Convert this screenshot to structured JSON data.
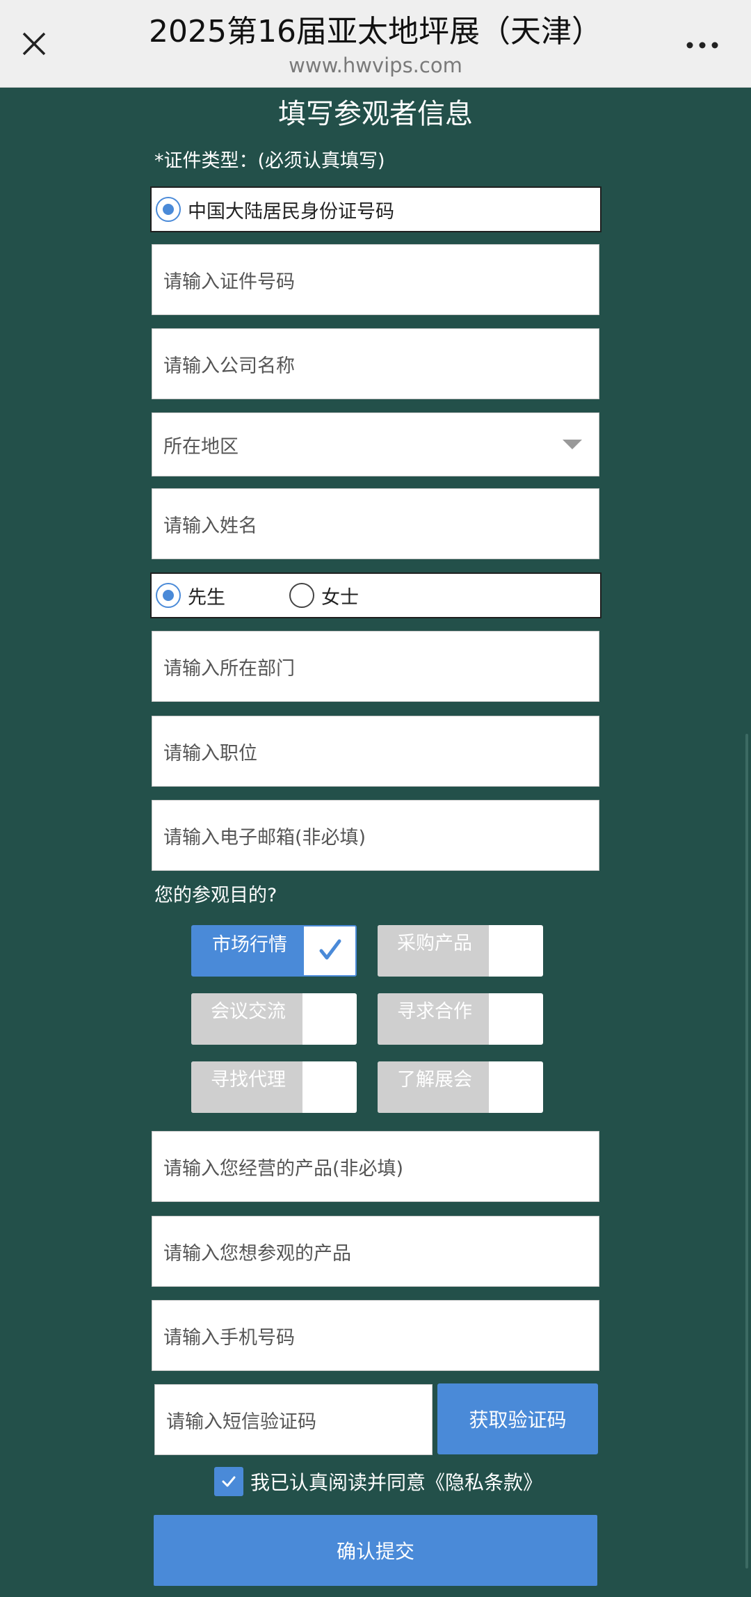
{
  "nav": {
    "title": "2025第16届亚太地坪展（天津）",
    "url": "www.hwvips.com"
  },
  "form": {
    "title": "填写参观者信息",
    "id_type_label": "*证件类型：(必须认真填写)",
    "id_type_option": "中国大陆居民身份证号码",
    "id_number_placeholder": "请输入证件号码",
    "company_placeholder": "请输入公司名称",
    "region_placeholder": "所在地区",
    "name_placeholder": "请输入姓名",
    "gender": {
      "options": [
        "先生",
        "女士"
      ],
      "selected": "先生"
    },
    "department_placeholder": "请输入所在部门",
    "position_placeholder": "请输入职位",
    "email_placeholder": "请输入电子邮箱(非必填)",
    "purpose_label": "您的参观目的?",
    "purposes": [
      {
        "label": "市场行情",
        "checked": true
      },
      {
        "label": "采购产品",
        "checked": false
      },
      {
        "label": "会议交流",
        "checked": false
      },
      {
        "label": "寻求合作",
        "checked": false
      },
      {
        "label": "寻找代理",
        "checked": false
      },
      {
        "label": "了解展会",
        "checked": false
      }
    ],
    "products_operated_placeholder": "请输入您经营的产品(非必填)",
    "products_wanted_placeholder": "请输入您想参观的产品",
    "phone_placeholder": "请输入手机号码",
    "sms_placeholder": "请输入短信验证码",
    "sms_button": "获取验证码",
    "agree_text": "我已认真阅读并同意《隐私条款》",
    "agree_checked": true,
    "submit_button": "确认提交"
  },
  "colors": {
    "background": "#23504a",
    "accent": "#4a8ad8",
    "unchecked_chip": "#cfcfcf"
  }
}
